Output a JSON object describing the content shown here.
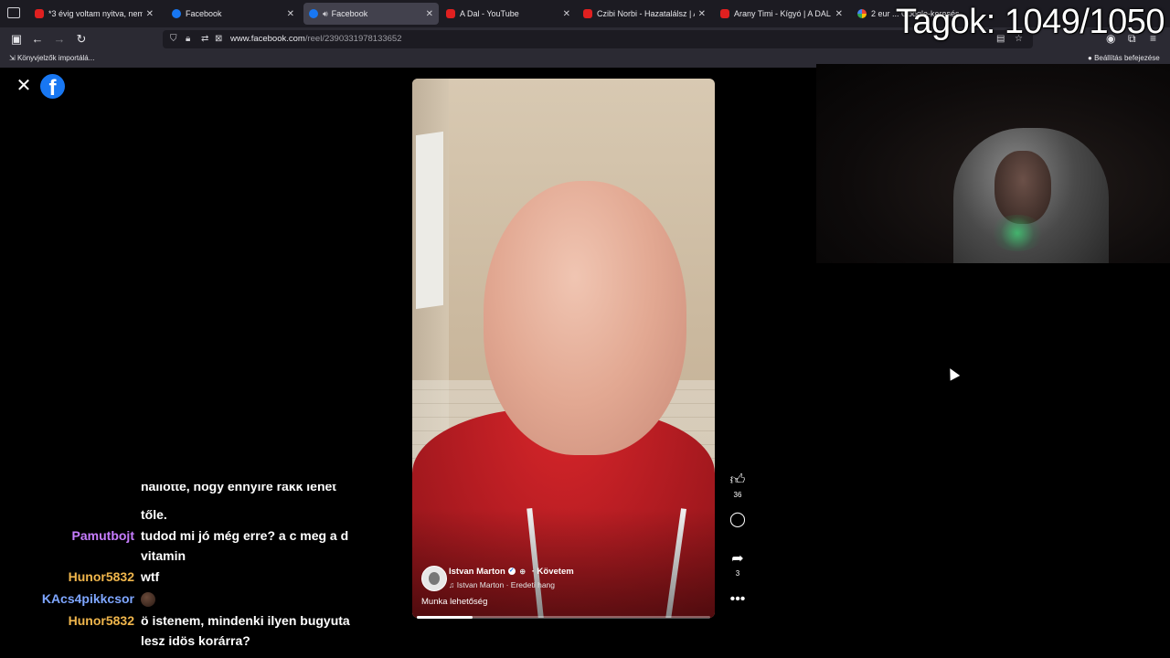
{
  "browser": {
    "tabs": [
      {
        "label": "*3 évig voltam nyitva, nem szer",
        "favicon": "youtube-icon",
        "active": false
      },
      {
        "label": "Facebook",
        "favicon": "facebook-icon",
        "active": false
      },
      {
        "label": "Facebook",
        "favicon": "facebook-icon",
        "active": true,
        "audio": true
      },
      {
        "label": "A Dal - YouTube",
        "favicon": "youtube-icon",
        "active": false
      },
      {
        "label": "Czibi Norbi - Hazatalálsz | A DAL",
        "favicon": "youtube-icon",
        "active": false
      },
      {
        "label": "Arany Timi - Kígyó | A DAL 2026",
        "favicon": "youtube-icon",
        "active": false
      },
      {
        "label": "2 eur ... Google-keresés",
        "favicon": "google-icon",
        "active": false
      }
    ],
    "url_domain": "www.facebook.com",
    "url_path": "/reel/2390331978133652",
    "bookmarks": {
      "left": "Könyvjelzők importálá...",
      "right": "Beállítás befejezése"
    }
  },
  "overlay": {
    "members_label": "Tagok: 1049/1050"
  },
  "reel": {
    "author": "Istvan Marton",
    "follow_label": "· Követem",
    "sound": "Istvan Marton · Eredeti hang",
    "caption": "Munka lehetőség",
    "likes": "36",
    "shares": "3",
    "progress": 0.19
  },
  "chat": {
    "lines": [
      {
        "user": "",
        "color": "#ffffff",
        "msg": "hallotte, hogy ennyire rakk lehet"
      },
      {
        "user": "",
        "color": "#ffffff",
        "msg": "tőle."
      },
      {
        "user": "Pamutbojt",
        "color": "#c77dff",
        "msg": "tudod mi jó még erre? a c meg a d vitamin"
      },
      {
        "user": "Hunor5832",
        "color": "#f0b64c",
        "msg": "wtf"
      },
      {
        "user": "KAcs4pikkcsor",
        "color": "#7ea6ff",
        "msg": ""
      },
      {
        "user": "Hunor5832",
        "color": "#f0b64c",
        "msg": "ö istenem, mindenki ilyen bugyuta lesz idös korárra?"
      }
    ]
  },
  "colors": {
    "facebook_blue": "#1877f2",
    "tab_bar": "#1c1b22",
    "toolbar": "#2b2a33"
  }
}
